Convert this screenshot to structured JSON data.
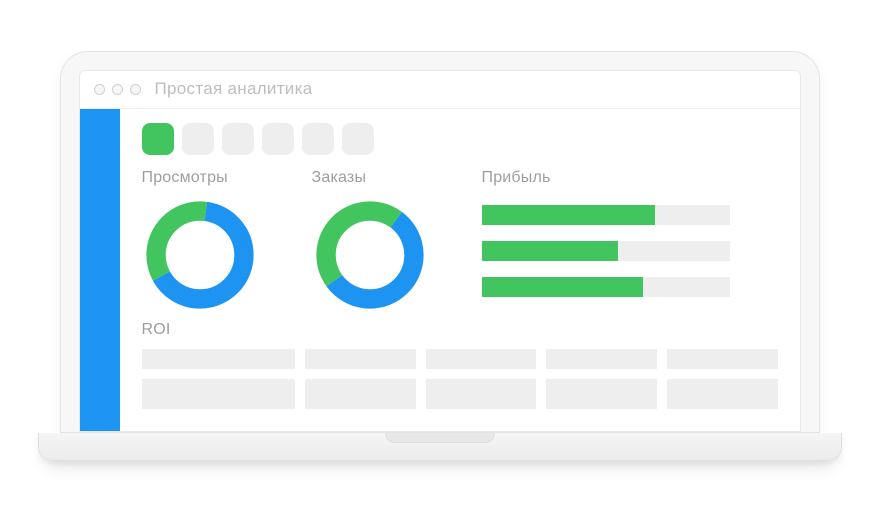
{
  "window": {
    "title": "Простая аналитика"
  },
  "tabs": [
    {
      "active": true
    },
    {
      "active": false
    },
    {
      "active": false
    },
    {
      "active": false
    },
    {
      "active": false
    },
    {
      "active": false
    }
  ],
  "metrics": {
    "views": {
      "label": "Просмотры"
    },
    "orders": {
      "label": "Заказы"
    },
    "profit": {
      "label": "Прибыль"
    }
  },
  "roi": {
    "label": "ROI"
  },
  "colors": {
    "accent_blue": "#1e94f2",
    "accent_green": "#42c55e",
    "placeholder_grey": "#eeeeee"
  },
  "chart_data": [
    {
      "type": "pie",
      "title": "Просмотры",
      "series": [
        {
          "name": "green",
          "value": 35,
          "color": "#42c55e"
        },
        {
          "name": "blue",
          "value": 65,
          "color": "#1e94f2"
        }
      ]
    },
    {
      "type": "pie",
      "title": "Заказы",
      "series": [
        {
          "name": "green",
          "value": 45,
          "color": "#42c55e"
        },
        {
          "name": "blue",
          "value": 55,
          "color": "#1e94f2"
        }
      ]
    },
    {
      "type": "bar",
      "title": "Прибыль",
      "categories": [
        "row1",
        "row2",
        "row3"
      ],
      "values": [
        70,
        55,
        65
      ],
      "ylim": [
        0,
        100
      ],
      "bar_color": "#42c55e",
      "track_color": "#eeeeee"
    }
  ]
}
